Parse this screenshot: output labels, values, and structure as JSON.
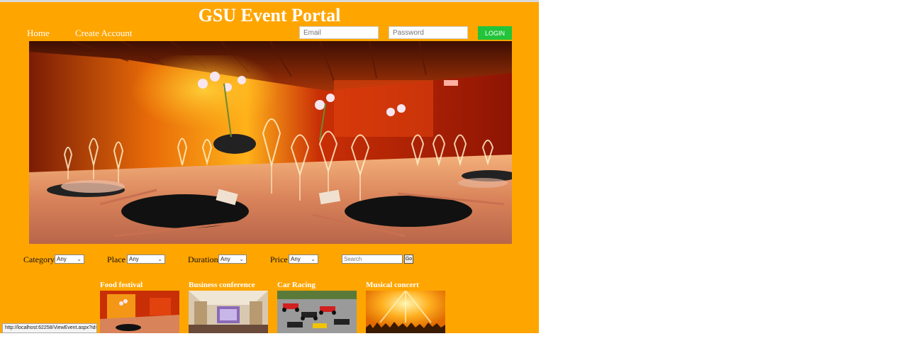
{
  "header": {
    "title": "GSU Event Portal"
  },
  "nav": {
    "home": "Home",
    "create_account": "Create Account"
  },
  "login": {
    "email_placeholder": "Email",
    "password_placeholder": "Password",
    "button": "LOGIN"
  },
  "filters": {
    "category": {
      "label": "Category",
      "value": "Any"
    },
    "place": {
      "label": "Place",
      "value": "Any"
    },
    "duration": {
      "label": "Duration",
      "value": "Any"
    },
    "price": {
      "label": "Price",
      "value": "Any"
    },
    "search_placeholder": "Search",
    "go_label": "Go"
  },
  "events": [
    {
      "name": "Food festival"
    },
    {
      "name": "Business conference"
    },
    {
      "name": "Car Racing"
    },
    {
      "name": "Musical concert"
    }
  ],
  "status_bar": {
    "url": "http://localhost:62258/ViewEvent.aspx?id=3"
  },
  "colors": {
    "page_bg": "#ffa500",
    "login_button": "#22c43a",
    "text_light": "#ffffff"
  }
}
